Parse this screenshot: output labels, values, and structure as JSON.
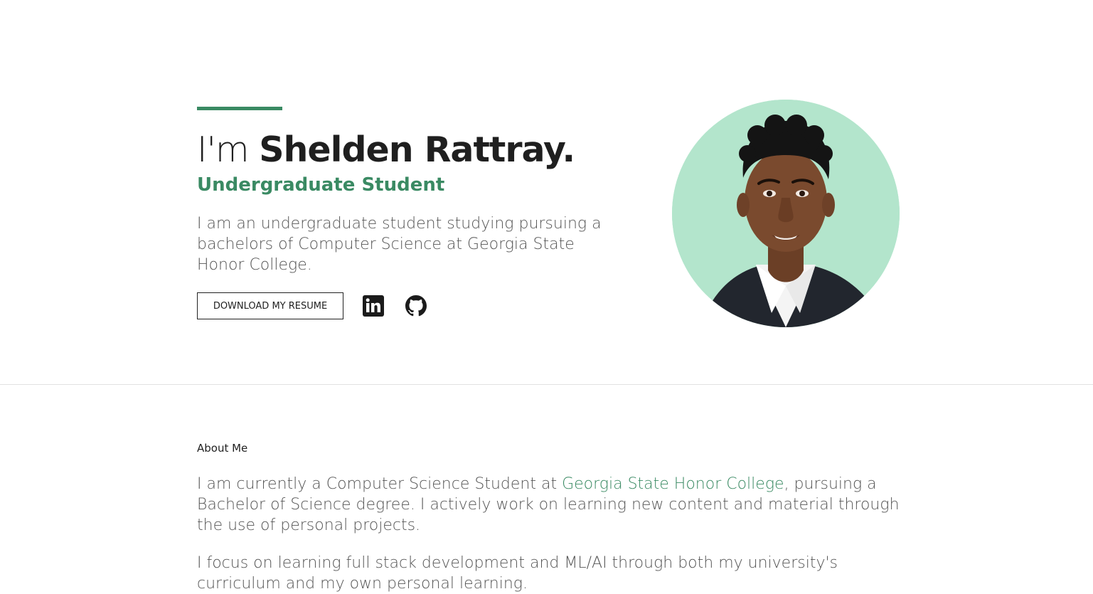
{
  "hero": {
    "greeting": "I'm ",
    "name": "Shelden Rattray.",
    "role": "Undergraduate Student",
    "intro": "I am an undergraduate student studying pursuing a bachelors of Computer Science at Georgia State Honor College.",
    "resume_button": "DOWNLOAD MY RESUME",
    "social": [
      {
        "icon": "linkedin-icon"
      },
      {
        "icon": "github-icon"
      }
    ],
    "avatar_bg": "#b3e5cc"
  },
  "about": {
    "label": "About Me",
    "p1_before": "I am currently a Computer Science Student at ",
    "p1_link": "Georgia State Honor College",
    "p1_after": ", pursuing a Bachelor of Science degree. I actively work on learning new content and material through the use of personal projects.",
    "p2": "I focus on learning full stack development and ML/AI through both my university's curriculum and my own personal learning."
  },
  "colors": {
    "accent": "#3a8a63",
    "text_dark": "#1f1f1f",
    "text_body": "#555555"
  }
}
